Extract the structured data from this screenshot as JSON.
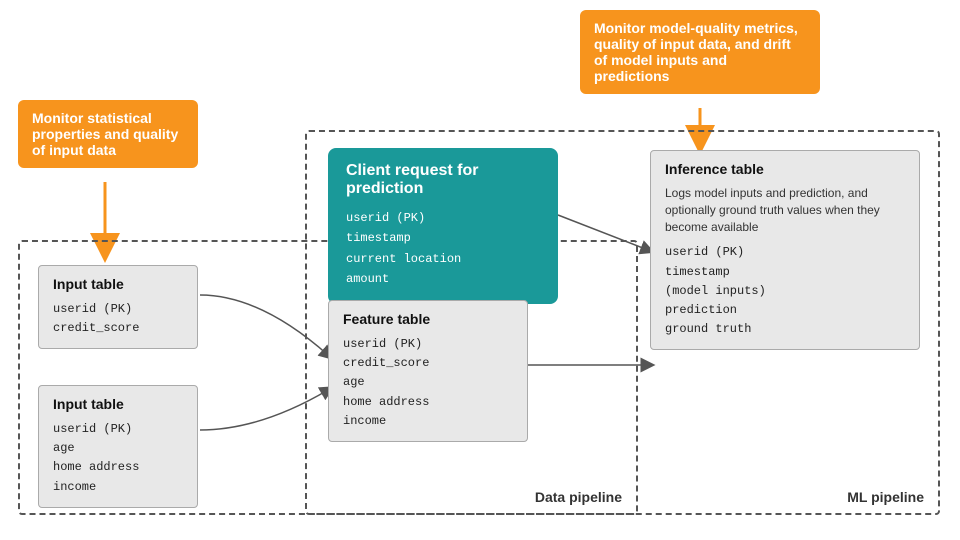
{
  "callouts": {
    "left": {
      "text": "Monitor statistical properties and quality of input data"
    },
    "right": {
      "text": "Monitor model-quality metrics, quality of input data, and drift of model inputs and predictions"
    }
  },
  "pipelines": {
    "data": {
      "label": "Data pipeline"
    },
    "ml": {
      "label": "ML pipeline"
    }
  },
  "client_request": {
    "title": "Client request for prediction",
    "fields": [
      "userid (PK)",
      "timestamp",
      "current location",
      "amount"
    ]
  },
  "input_table_1": {
    "title": "Input table",
    "fields": [
      "userid (PK)",
      "credit_score"
    ]
  },
  "input_table_2": {
    "title": "Input table",
    "fields": [
      "userid (PK)",
      "age",
      "home address",
      "income"
    ]
  },
  "feature_table": {
    "title": "Feature table",
    "fields": [
      "userid (PK)",
      "credit_score",
      "age",
      "home address",
      "income"
    ]
  },
  "inference_table": {
    "title": "Inference table",
    "description": "Logs model inputs and prediction, and optionally ground truth values when they become available",
    "fields": [
      "userid (PK)",
      "timestamp",
      "(model inputs)",
      "prediction",
      "ground truth"
    ]
  }
}
